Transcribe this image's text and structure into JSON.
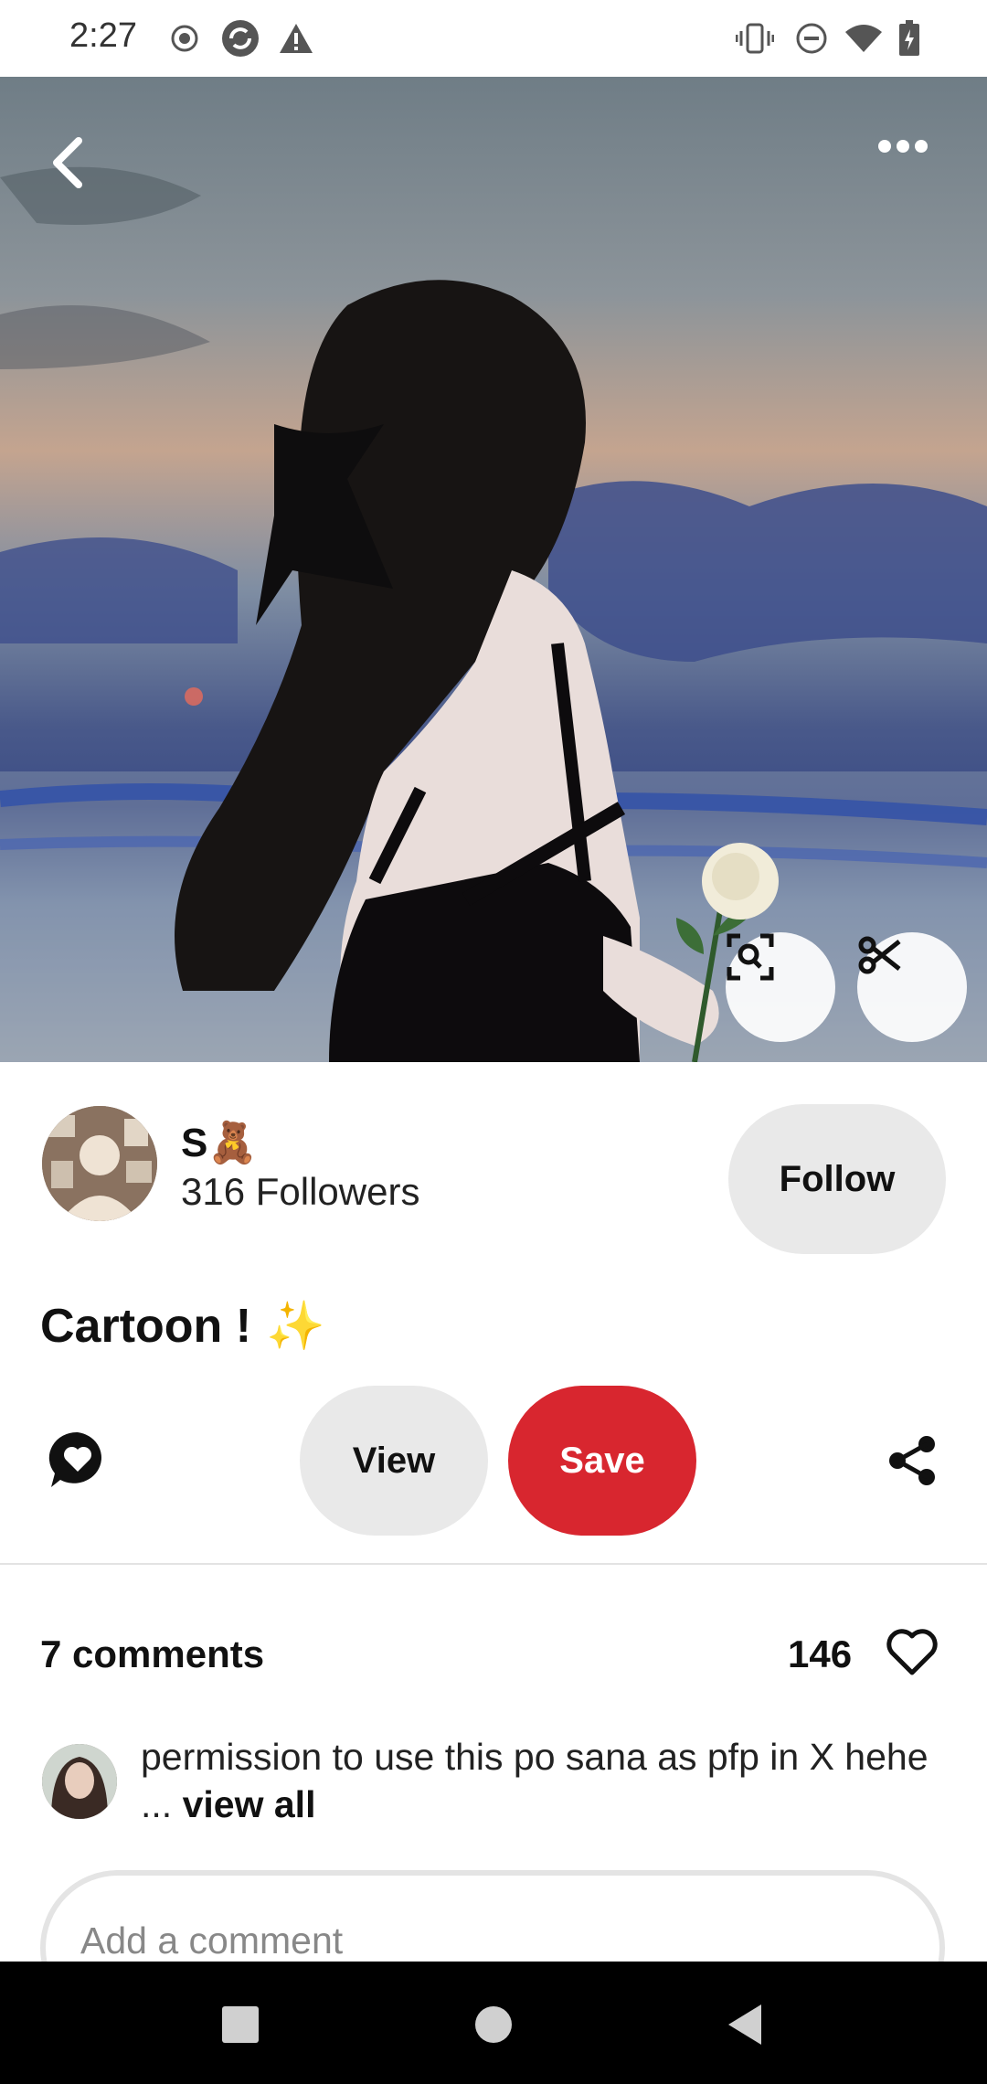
{
  "status_bar": {
    "time": "2:27",
    "left_icons": [
      "record-icon",
      "sync-icon",
      "alert-icon"
    ],
    "right_icons": [
      "vibrate-icon",
      "do-not-disturb-icon",
      "wifi-icon",
      "battery-charging-icon"
    ]
  },
  "hero": {
    "left_icon": "back-icon",
    "right_icon": "more-icon",
    "bottom_icons": [
      "visual-search-icon",
      "scissors-icon"
    ]
  },
  "creator": {
    "name": "S",
    "name_emoji": "🧸",
    "followers": "316 Followers",
    "follow_label": "Follow"
  },
  "pin": {
    "title": "Cartoon !",
    "title_emoji": "✨"
  },
  "actions": {
    "comment_icon": "chat-heart-icon",
    "view_label": "View",
    "save_label": "Save",
    "share_icon": "share-icon",
    "save_color": "#d8262f"
  },
  "comments": {
    "count_label": "7 comments",
    "likes": "146",
    "like_icon": "heart-outline-icon",
    "top_comment": {
      "text": "permission to use this po sana as pfp in X hehe ...",
      "view_all": "view all"
    },
    "input_placeholder": "Add a comment"
  },
  "nav": {
    "icons": [
      "recents-square-icon",
      "home-circle-icon",
      "back-triangle-icon"
    ]
  }
}
